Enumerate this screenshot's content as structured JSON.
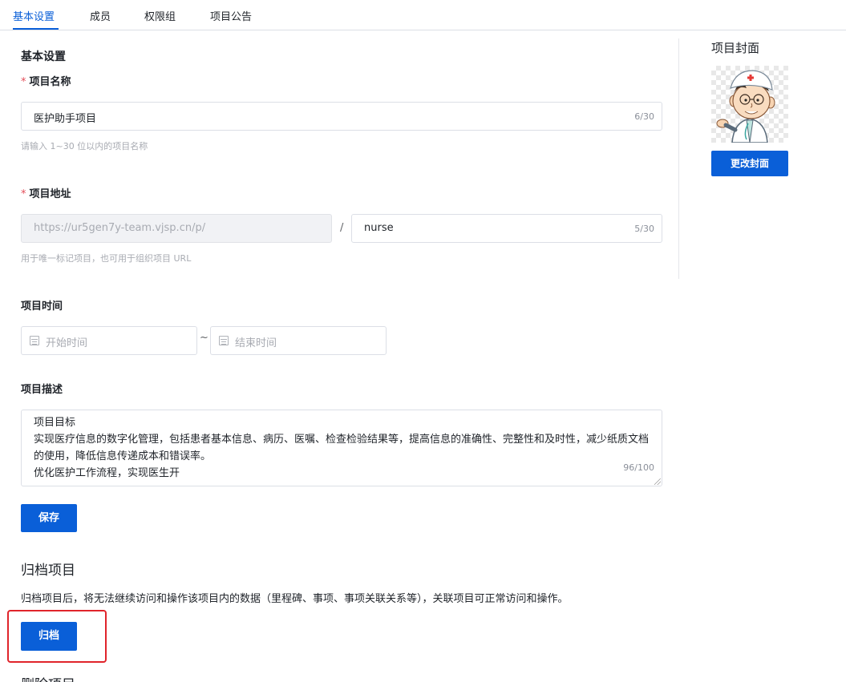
{
  "tabs": [
    {
      "label": "基本设置",
      "active": true
    },
    {
      "label": "成员",
      "active": false
    },
    {
      "label": "权限组",
      "active": false
    },
    {
      "label": "项目公告",
      "active": false
    }
  ],
  "basic": {
    "section_title": "基本设置",
    "required_mark": "*",
    "name_label": "项目名称",
    "name_value": "医护助手项目",
    "name_count": "6/30",
    "name_hint": "请输入 1~30 位以内的项目名称",
    "address_label": "项目地址",
    "address_prefix": "https://ur5gen7y-team.vjsp.cn/p/",
    "address_separator": "/",
    "address_value": "nurse",
    "address_count": "5/30",
    "address_hint": "用于唯一标记项目，也可用于组织项目 URL",
    "time_label": "项目时间",
    "start_placeholder": "开始时间",
    "time_separator": "~",
    "end_placeholder": "结束时间",
    "desc_label": "项目描述",
    "desc_value": "项目目标\n实现医疗信息的数字化管理，包括患者基本信息、病历、医嘱、检查检验结果等，提高信息的准确性、完整性和及时性，减少纸质文档的使用，降低信息传递成本和错误率。\n优化医护工作流程，实现医生开",
    "desc_count": "96/100",
    "save_label": "保存"
  },
  "archive": {
    "title": "归档项目",
    "description": "归档项目后，将无法继续访问和操作该项目内的数据（里程碑、事项、事项关联关系等），关联项目可正常访问和操作。",
    "button_label": "归档"
  },
  "delete": {
    "title": "删除项目"
  },
  "cover": {
    "title": "项目封面",
    "change_label": "更改封面",
    "image_icon": "cartoon-doctor"
  },
  "colors": {
    "accent": "#0a5fd8",
    "required": "#e34d59",
    "highlight": "#e0242b"
  }
}
